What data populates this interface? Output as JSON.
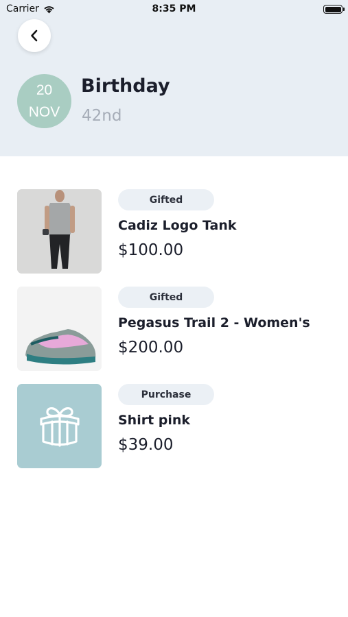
{
  "status_bar": {
    "carrier": "Carrier",
    "time": "8:35 PM"
  },
  "header": {
    "back_icon": "chevron-left-icon",
    "date": {
      "day": "20",
      "month": "NOV"
    },
    "title": "Birthday",
    "subtitle": "42nd"
  },
  "colors": {
    "header_bg": "#e8eef4",
    "date_badge": "#a9cdc2",
    "tag_bg": "#ebf0f5",
    "gift_placeholder_bg": "#a9ccd2"
  },
  "gifts": [
    {
      "status": "Gifted",
      "name": "Cadiz Logo Tank",
      "price": "$100.00",
      "image": "tank-top-photo"
    },
    {
      "status": "Gifted",
      "name": "Pegasus Trail 2 - Women's",
      "price": "$200.00",
      "image": "running-shoe-photo"
    },
    {
      "status": "Purchase",
      "name": "Shirt pink",
      "price": "$39.00",
      "image": "gift-box-icon"
    }
  ]
}
